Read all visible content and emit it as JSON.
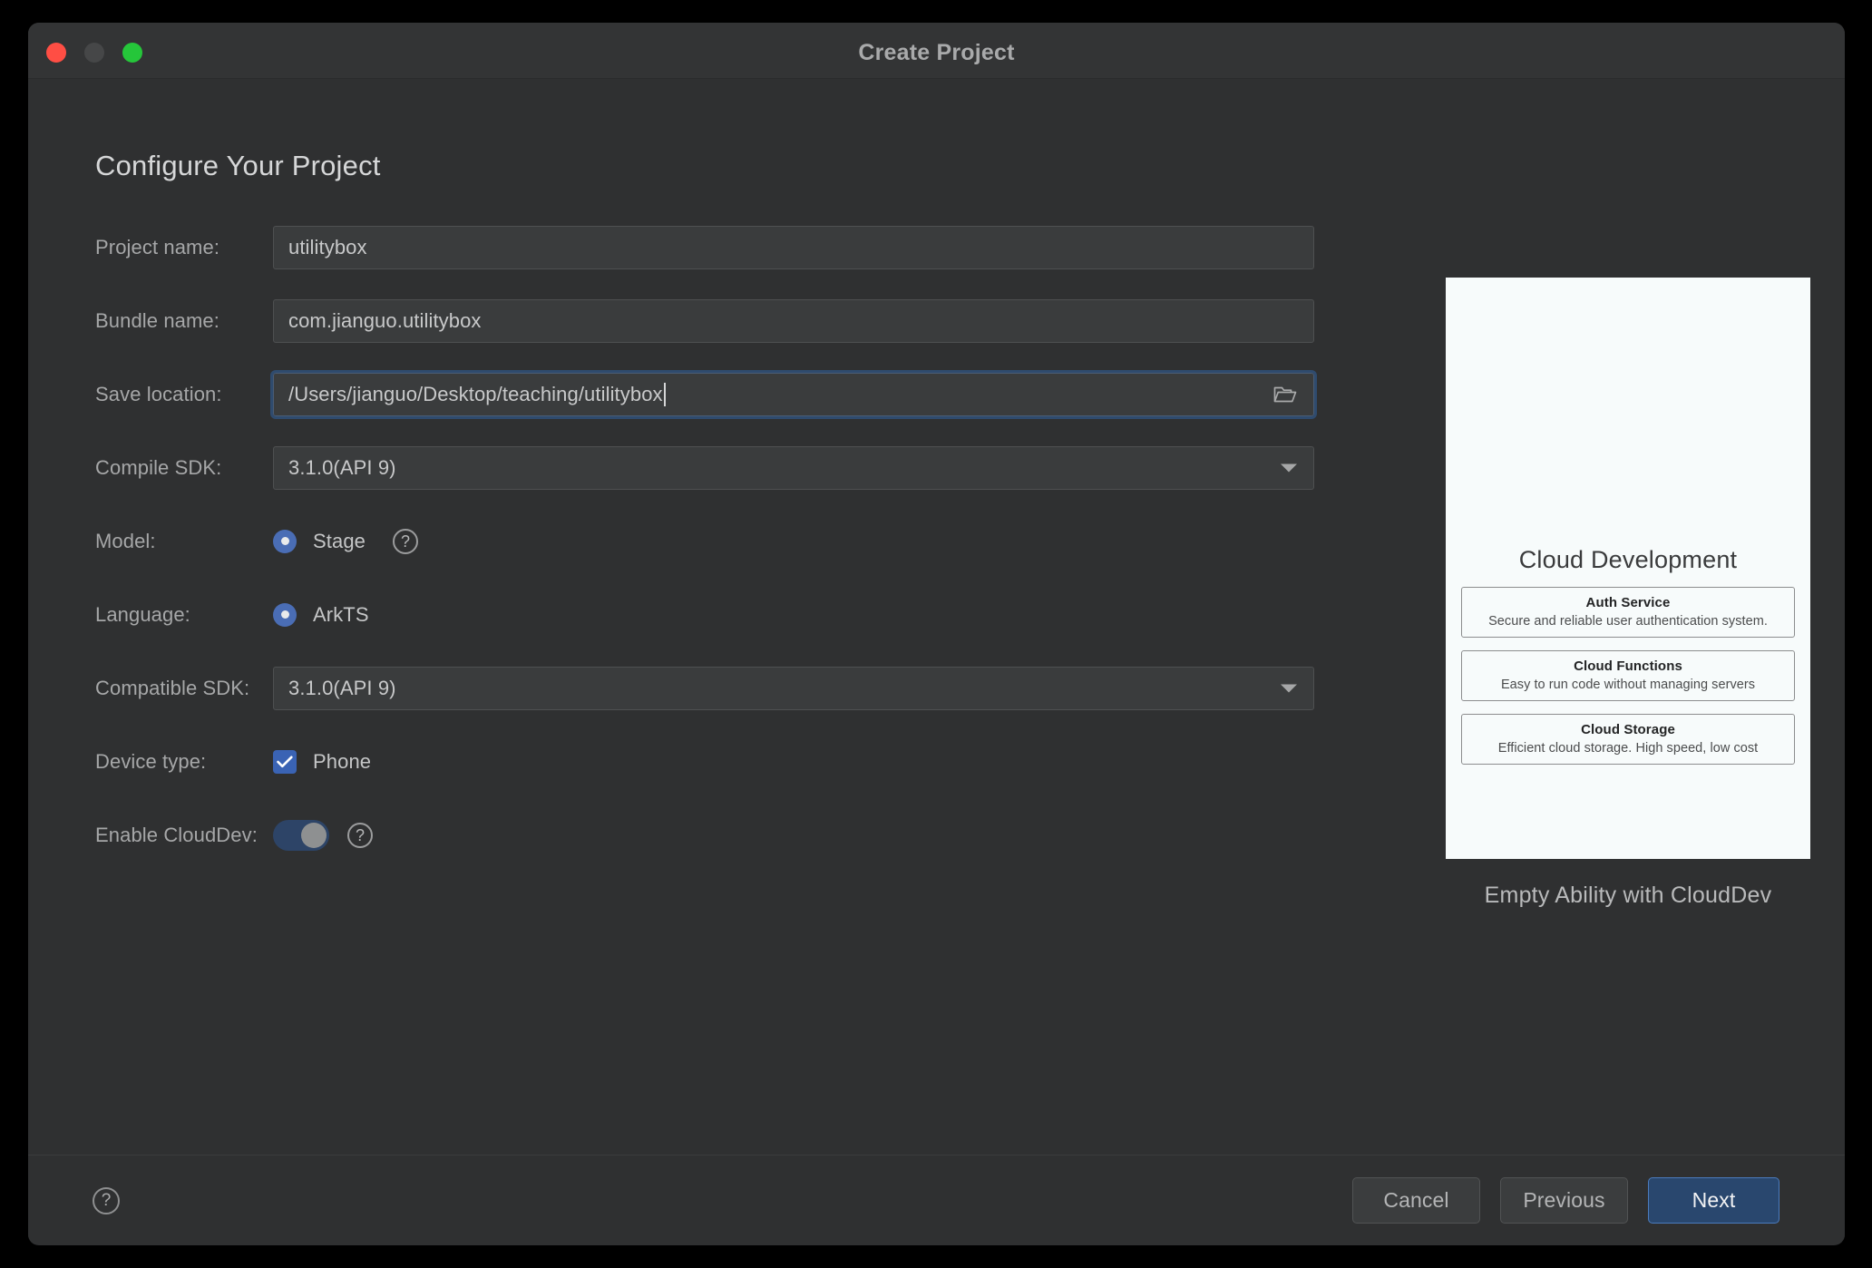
{
  "window": {
    "title": "Create Project",
    "traffic_lights": [
      {
        "name": "close",
        "color": "#FF4E44"
      },
      {
        "name": "minimize",
        "color": "#464748"
      },
      {
        "name": "zoom",
        "color": "#25C63A"
      }
    ]
  },
  "page": {
    "heading": "Configure Your Project"
  },
  "form": {
    "project_name": {
      "label": "Project name:",
      "value": "utilitybox",
      "placeholder": ""
    },
    "bundle_name": {
      "label": "Bundle name:",
      "value": "com.jianguo.utilitybox",
      "placeholder": ""
    },
    "save_location": {
      "label": "Save location:",
      "value": "/Users/jianguo/Desktop/teaching/utilitybox",
      "placeholder": "",
      "browse_icon": "folder-open-icon",
      "focused": true
    },
    "compile_sdk": {
      "label": "Compile SDK:",
      "value": "3.1.0(API 9)",
      "options": [
        "3.1.0(API 9)"
      ]
    },
    "model": {
      "label": "Model:",
      "option_label": "Stage",
      "selected": true,
      "help_icon": "question-mark-icon"
    },
    "language": {
      "label": "Language:",
      "option_label": "ArkTS",
      "selected": true
    },
    "compatible_sdk": {
      "label": "Compatible SDK:",
      "value": "3.1.0(API 9)",
      "options": [
        "3.1.0(API 9)"
      ]
    },
    "device_type": {
      "label": "Device type:",
      "option_label": "Phone",
      "checked": true
    },
    "enable_clouddev": {
      "label": "Enable CloudDev:",
      "enabled": true,
      "help_icon": "question-mark-icon"
    }
  },
  "preview": {
    "title": "Cloud Development",
    "features": [
      {
        "name": "Auth Service",
        "description": "Secure and reliable user authentication system."
      },
      {
        "name": "Cloud Functions",
        "description": "Easy to run code without managing servers"
      },
      {
        "name": "Cloud Storage",
        "description": "Efficient cloud storage. High speed, low cost"
      }
    ],
    "caption": "Empty Ability with CloudDev"
  },
  "footer": {
    "help_icon": "question-mark-icon",
    "cancel_label": "Cancel",
    "previous_label": "Previous",
    "next_label": "Next"
  },
  "colors": {
    "accent_blue": "#4A6DB5",
    "primary_button": "#29476E",
    "primary_button_border": "#4B7BBD",
    "focus_border": "#2F4B6E",
    "window_bg": "#2F3031",
    "field_bg": "#3A3C3D",
    "preview_bg": "#F7FBFB"
  }
}
